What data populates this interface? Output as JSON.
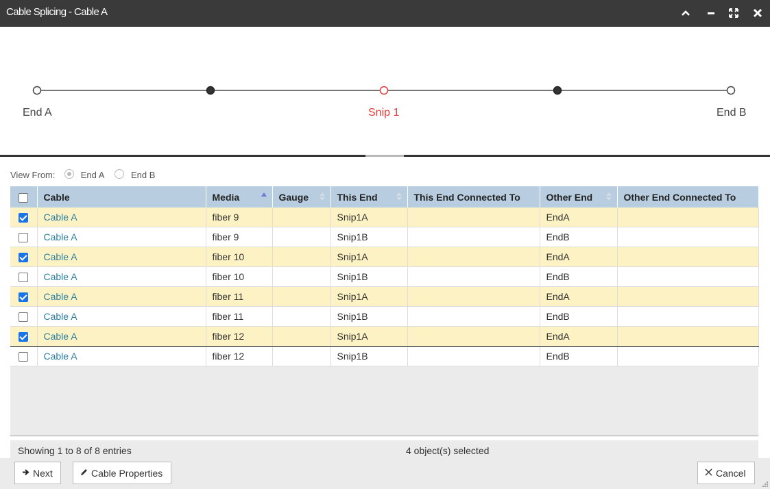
{
  "window": {
    "title": "Cable Splicing - Cable A"
  },
  "diagram": {
    "nodes": [
      {
        "label": "End A",
        "color": "#444444"
      },
      {
        "label": "Snip 1",
        "color": "#e53935"
      },
      {
        "label": "End B",
        "color": "#444444"
      }
    ]
  },
  "view_from": {
    "label": "View From:",
    "options": [
      {
        "label": "End A",
        "selected": true
      },
      {
        "label": "End B",
        "selected": false
      }
    ]
  },
  "table": {
    "columns": [
      "Cable",
      "Media",
      "Gauge",
      "This End",
      "This End Connected To",
      "Other End",
      "Other End Connected To"
    ],
    "rows": [
      {
        "checked": true,
        "cable": "Cable A",
        "media": "fiber 9",
        "gauge": "",
        "this_end": "Snip1A",
        "this_end_connected_to": "",
        "other_end": "EndA",
        "other_end_connected_to": ""
      },
      {
        "checked": false,
        "cable": "Cable A",
        "media": "fiber 9",
        "gauge": "",
        "this_end": "Snip1B",
        "this_end_connected_to": "",
        "other_end": "EndB",
        "other_end_connected_to": ""
      },
      {
        "checked": true,
        "cable": "Cable A",
        "media": "fiber 10",
        "gauge": "",
        "this_end": "Snip1A",
        "this_end_connected_to": "",
        "other_end": "EndA",
        "other_end_connected_to": ""
      },
      {
        "checked": false,
        "cable": "Cable A",
        "media": "fiber 10",
        "gauge": "",
        "this_end": "Snip1B",
        "this_end_connected_to": "",
        "other_end": "EndB",
        "other_end_connected_to": ""
      },
      {
        "checked": true,
        "cable": "Cable A",
        "media": "fiber 11",
        "gauge": "",
        "this_end": "Snip1A",
        "this_end_connected_to": "",
        "other_end": "EndA",
        "other_end_connected_to": ""
      },
      {
        "checked": false,
        "cable": "Cable A",
        "media": "fiber 11",
        "gauge": "",
        "this_end": "Snip1B",
        "this_end_connected_to": "",
        "other_end": "EndB",
        "other_end_connected_to": ""
      },
      {
        "checked": true,
        "cable": "Cable A",
        "media": "fiber 12",
        "gauge": "",
        "this_end": "Snip1A",
        "this_end_connected_to": "",
        "other_end": "EndA",
        "other_end_connected_to": ""
      },
      {
        "checked": false,
        "cable": "Cable A",
        "media": "fiber 12",
        "gauge": "",
        "this_end": "Snip1B",
        "this_end_connected_to": "",
        "other_end": "EndB",
        "other_end_connected_to": ""
      }
    ]
  },
  "footer": {
    "showing": "Showing 1 to 8 of 8 entries",
    "selected": "4 object(s) selected"
  },
  "buttons": {
    "next": "Next",
    "cable_properties": "Cable Properties",
    "cancel": "Cancel"
  },
  "colors": {
    "titlebar": "#3a3a3a",
    "header": "#b8cde0",
    "selected_row": "#fcf2c3",
    "link": "#2a7ea0",
    "snip": "#e53935"
  }
}
